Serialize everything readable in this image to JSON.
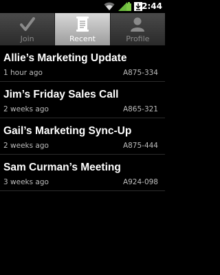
{
  "status_bar": {
    "time": "2:44",
    "icons": [
      "wifi-icon",
      "signal-icon",
      "download-icon",
      "battery-icon"
    ]
  },
  "tabs": [
    {
      "label": "Join",
      "icon": "check-icon",
      "selected": false
    },
    {
      "label": "Recent",
      "icon": "document-icon",
      "selected": true
    },
    {
      "label": "Profile",
      "icon": "person-icon",
      "selected": false
    }
  ],
  "meetings": [
    {
      "title": "Allie’s Marketing Update",
      "time_ago": "1 hour ago",
      "code": "A875-334"
    },
    {
      "title": "Jim’s Friday Sales Call",
      "time_ago": "2 weeks ago",
      "code": "A865-321"
    },
    {
      "title": "Gail’s Marketing Sync-Up",
      "time_ago": "2 weeks ago",
      "code": "A875-444"
    },
    {
      "title": "Sam Curman’s Meeting",
      "time_ago": "3 weeks ago",
      "code": "A924-098"
    }
  ]
}
